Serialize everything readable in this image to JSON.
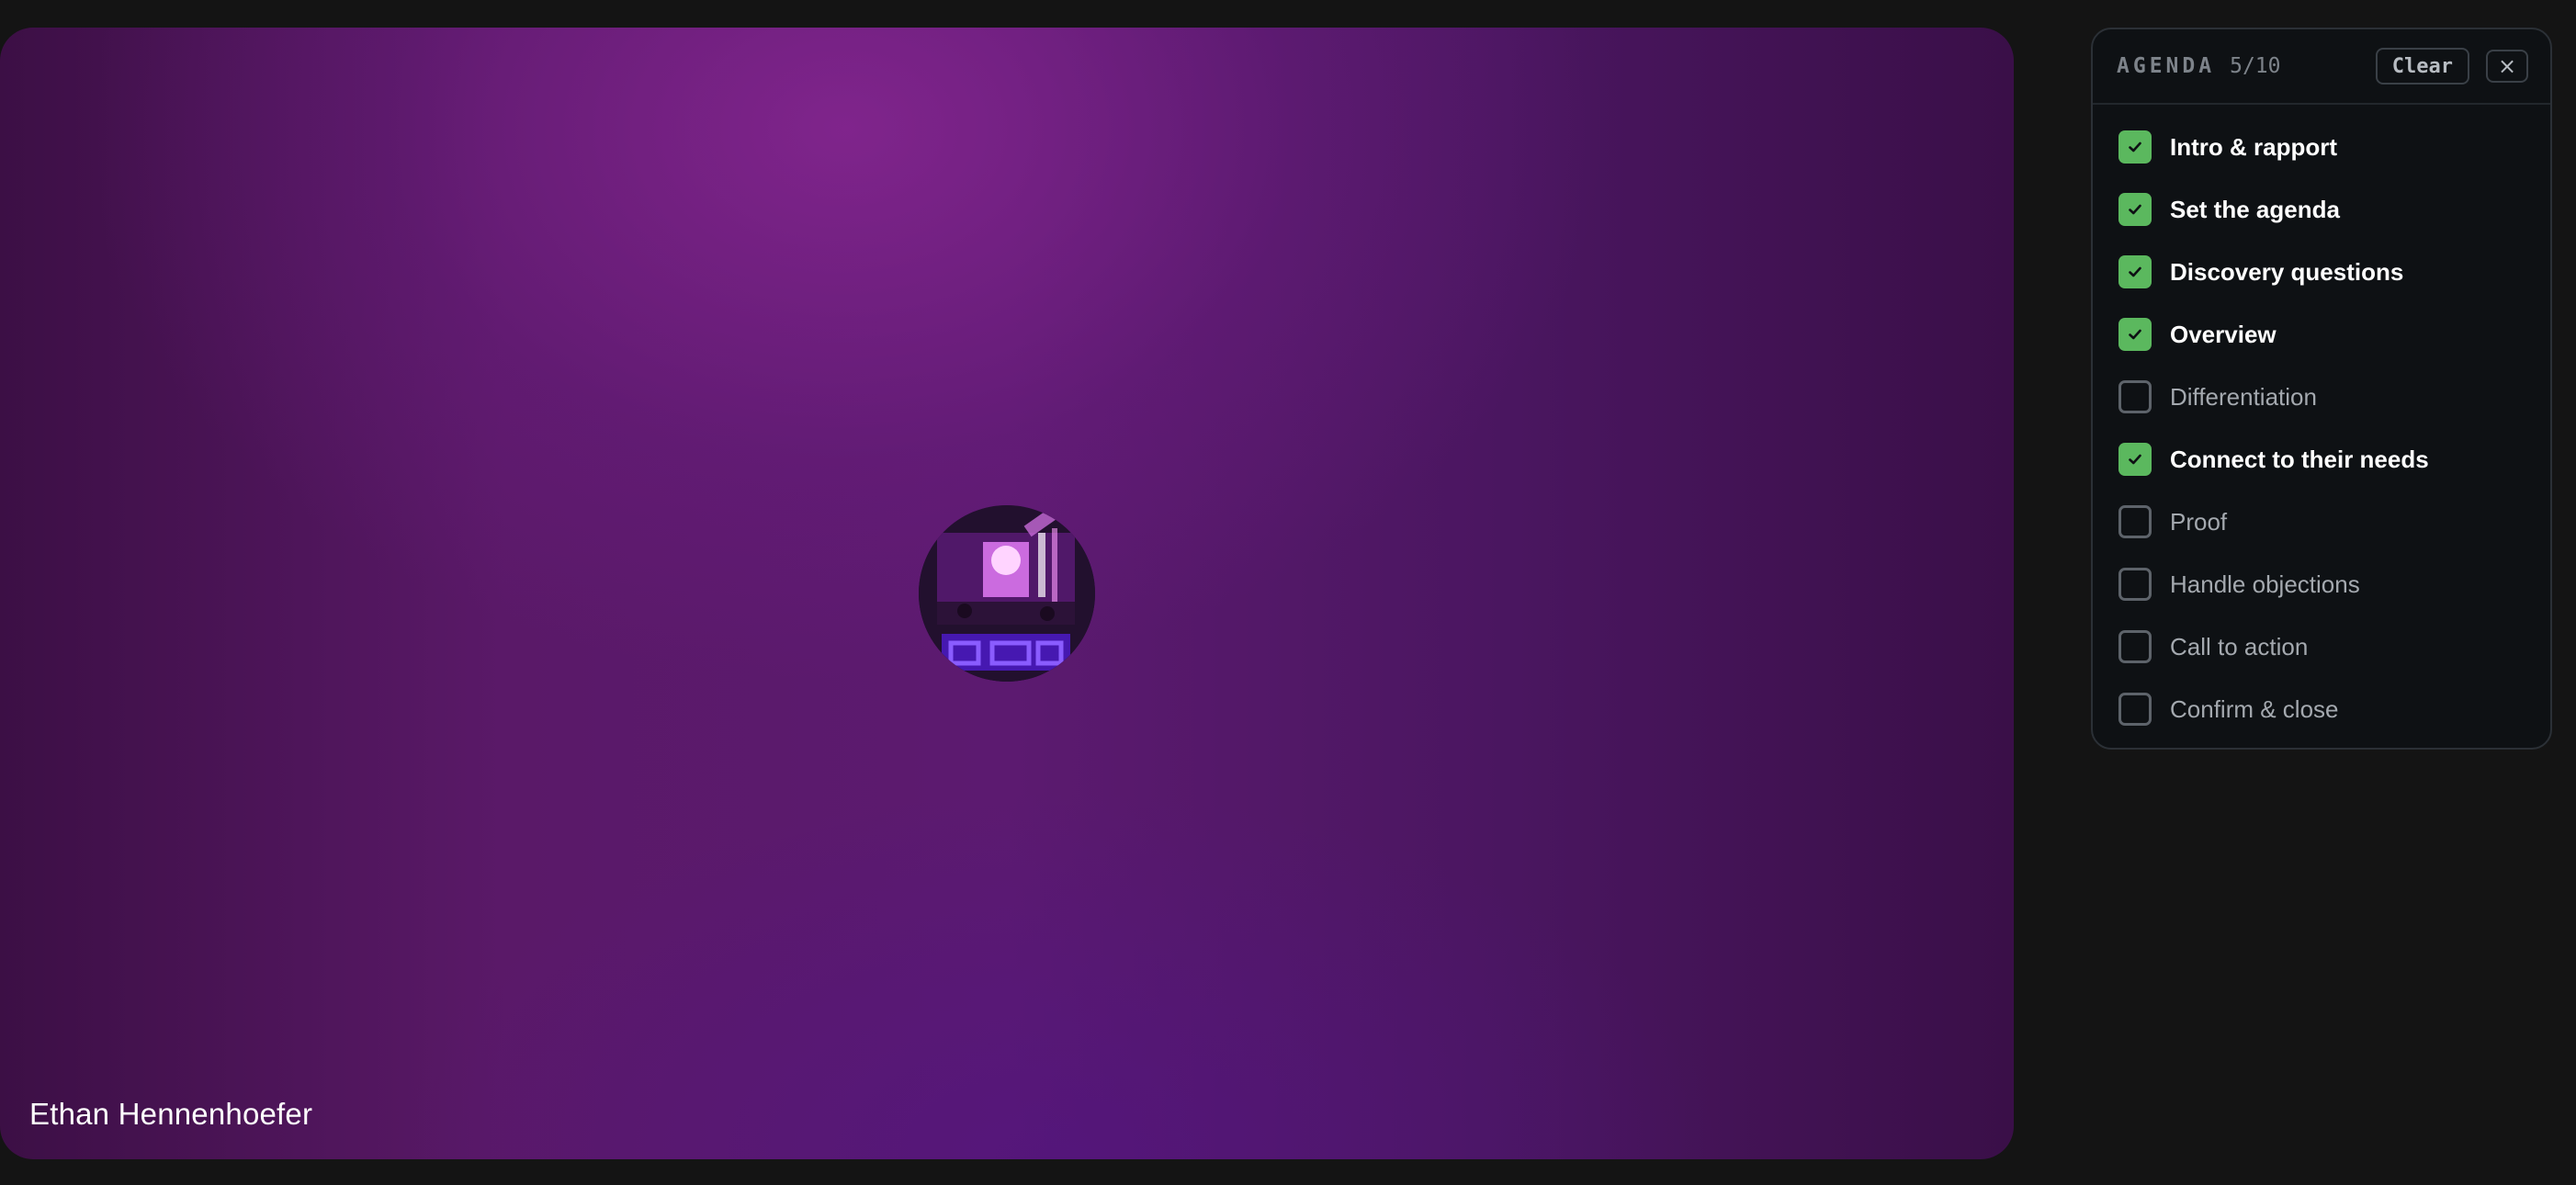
{
  "participant": {
    "name": "Ethan Hennenhoefer"
  },
  "agenda": {
    "title": "AGENDA",
    "count": "5/10",
    "clear_label": "Clear",
    "close_symbol": "×",
    "items": [
      {
        "label": "Intro & rapport",
        "checked": true
      },
      {
        "label": "Set the agenda",
        "checked": true
      },
      {
        "label": "Discovery questions",
        "checked": true
      },
      {
        "label": "Overview",
        "checked": true
      },
      {
        "label": "Differentiation",
        "checked": false
      },
      {
        "label": "Connect to their needs",
        "checked": true
      },
      {
        "label": "Proof",
        "checked": false
      },
      {
        "label": "Handle objections",
        "checked": false
      },
      {
        "label": "Call to action",
        "checked": false
      },
      {
        "label": "Confirm & close",
        "checked": false
      }
    ]
  },
  "colors": {
    "checked": "#5bb85e",
    "panel_bg": "#0e1114",
    "page_bg": "#141414",
    "tile_accent": "#6a1f7c"
  },
  "icons": {
    "check": "check-icon",
    "close": "close-icon"
  }
}
